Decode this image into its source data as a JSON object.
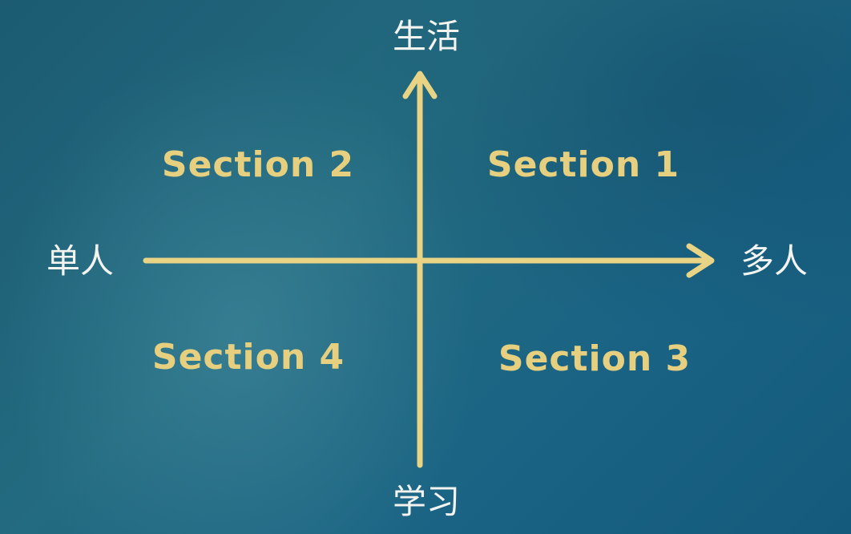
{
  "axes": {
    "top": "生活",
    "bottom": "学习",
    "left": "单人",
    "right": "多人"
  },
  "quadrants": {
    "top_right": "Section 1",
    "top_left": "Section 2",
    "bottom_right": "Section 3",
    "bottom_left": "Section 4"
  },
  "colors": {
    "axis": "#e8d484",
    "quadrant_text": "#e6d07f",
    "axis_text": "#f3f3f0",
    "background": "#1f6580"
  }
}
